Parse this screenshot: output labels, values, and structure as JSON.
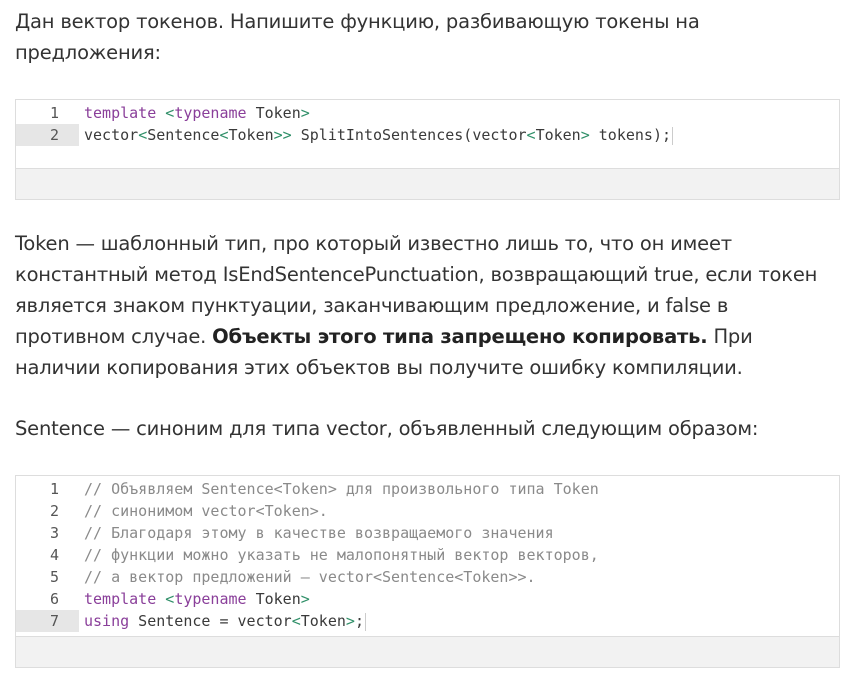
{
  "intro": {
    "line1": "Дан вектор токенов. Напишите функцию, разбивающую токены на",
    "line2": "предложения:"
  },
  "code1": {
    "lines": [
      {
        "num": "1",
        "parts": [
          {
            "t": "template",
            "c": "kw"
          },
          {
            "t": " ",
            "c": "id"
          },
          {
            "t": "<",
            "c": "br"
          },
          {
            "t": "typename",
            "c": "kw"
          },
          {
            "t": " Token",
            "c": "id"
          },
          {
            "t": ">",
            "c": "br"
          }
        ]
      },
      {
        "num": "2",
        "parts": [
          {
            "t": "vector",
            "c": "id"
          },
          {
            "t": "<",
            "c": "br"
          },
          {
            "t": "Sentence",
            "c": "id"
          },
          {
            "t": "<",
            "c": "br"
          },
          {
            "t": "Token",
            "c": "id"
          },
          {
            "t": ">>",
            "c": "br"
          },
          {
            "t": " SplitIntoSentences(vector",
            "c": "id"
          },
          {
            "t": "<",
            "c": "br"
          },
          {
            "t": "Token",
            "c": "id"
          },
          {
            "t": ">",
            "c": "br"
          },
          {
            "t": " tokens);",
            "c": "id"
          }
        ]
      }
    ]
  },
  "token_para": {
    "l1": "Token — шаблонный тип, про который известно лишь то, что он имеет",
    "l2": "константный метод IsEndSentencePunctuation, возвращающий true, если токен",
    "l3": "является знаком пунктуации, заканчивающим предложение, и false в",
    "l4_pre": "противном случае. ",
    "l4_bold": "Объекты этого типа запрещено копировать.",
    "l4_post": " При",
    "l5": "наличии копирования этих объектов вы получите ошибку компиляции."
  },
  "sentence_para": {
    "text": "Sentence — синоним для типа vector, объявленный следующим образом:"
  },
  "code2": {
    "lines": [
      {
        "num": "1",
        "parts": [
          {
            "t": "// Объявляем Sentence<Token> для произвольного типа Token",
            "c": "cm"
          }
        ]
      },
      {
        "num": "2",
        "parts": [
          {
            "t": "// синонимом vector<Token>.",
            "c": "cm"
          }
        ]
      },
      {
        "num": "3",
        "parts": [
          {
            "t": "// Благодаря этому в качестве возвращаемого значения",
            "c": "cm"
          }
        ]
      },
      {
        "num": "4",
        "parts": [
          {
            "t": "// функции можно указать не малопонятный вектор векторов,",
            "c": "cm"
          }
        ]
      },
      {
        "num": "5",
        "parts": [
          {
            "t": "// а вектор предложений — vector<Sentence<Token>>.",
            "c": "cm"
          }
        ]
      },
      {
        "num": "6",
        "parts": [
          {
            "t": "template",
            "c": "kw"
          },
          {
            "t": " ",
            "c": "id"
          },
          {
            "t": "<",
            "c": "br"
          },
          {
            "t": "typename",
            "c": "kw"
          },
          {
            "t": " Token",
            "c": "id"
          },
          {
            "t": ">",
            "c": "br"
          }
        ]
      },
      {
        "num": "7",
        "parts": [
          {
            "t": "using",
            "c": "kw"
          },
          {
            "t": " Sentence = vector",
            "c": "id"
          },
          {
            "t": "<",
            "c": "br"
          },
          {
            "t": "Token",
            "c": "id"
          },
          {
            "t": ">",
            "c": "br"
          },
          {
            "t": ";",
            "c": "id"
          }
        ]
      }
    ]
  }
}
